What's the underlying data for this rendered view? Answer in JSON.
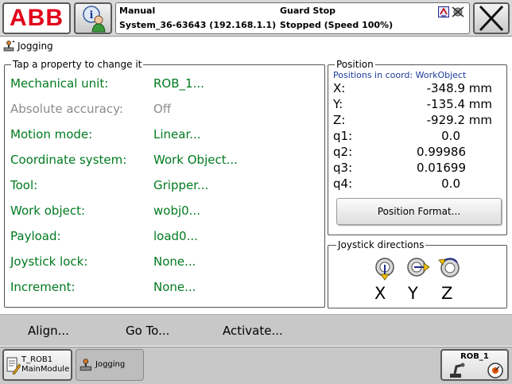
{
  "brand": {
    "logo_text": "ABB",
    "logo_color": "#e2001a"
  },
  "status": {
    "mode": "Manual",
    "system": "System_36-63643 (192.168.1.1)",
    "guard": "Guard Stop",
    "state": "Stopped (Speed 100%)"
  },
  "window": {
    "title": "Jogging"
  },
  "properties": {
    "legend": "Tap a property to change it",
    "rows": [
      {
        "label": "Mechanical unit:",
        "value": "ROB_1..."
      },
      {
        "label": "Absolute accuracy:",
        "value": "Off"
      },
      {
        "label": "Motion mode:",
        "value": "Linear..."
      },
      {
        "label": "Coordinate system:",
        "value": "Work Object..."
      },
      {
        "label": "Tool:",
        "value": "Gripper..."
      },
      {
        "label": "Work object:",
        "value": "wobj0..."
      },
      {
        "label": "Payload:",
        "value": "load0..."
      },
      {
        "label": "Joystick lock:",
        "value": "None..."
      },
      {
        "label": "Increment:",
        "value": "None..."
      }
    ]
  },
  "position": {
    "legend": "Position",
    "coord_label": "Positions in coord: WorkObject",
    "rows": [
      {
        "label": "X:",
        "value": "-348.9 mm"
      },
      {
        "label": "Y:",
        "value": "-135.4 mm"
      },
      {
        "label": "Z:",
        "value": "-929.2 mm"
      },
      {
        "label": "q1:",
        "value": "0.0"
      },
      {
        "label": "q2:",
        "value": "0.99986"
      },
      {
        "label": "q3:",
        "value": "0.01699"
      },
      {
        "label": "q4:",
        "value": "0.0"
      }
    ],
    "format_button": "Position Format..."
  },
  "joystick": {
    "legend": "Joystick directions",
    "axes": [
      "X",
      "Y",
      "Z"
    ]
  },
  "commands": {
    "align": "Align...",
    "goto": "Go To...",
    "activate": "Activate..."
  },
  "taskbar": {
    "trob_line1": "T_ROB1",
    "trob_line2": "MainModule",
    "jogging": "Jogging",
    "rob": "ROB_1"
  },
  "colors": {
    "property_text": "#007a1f",
    "disabled_text": "#8c8c8c",
    "coord_text": "#1a3a9a"
  }
}
